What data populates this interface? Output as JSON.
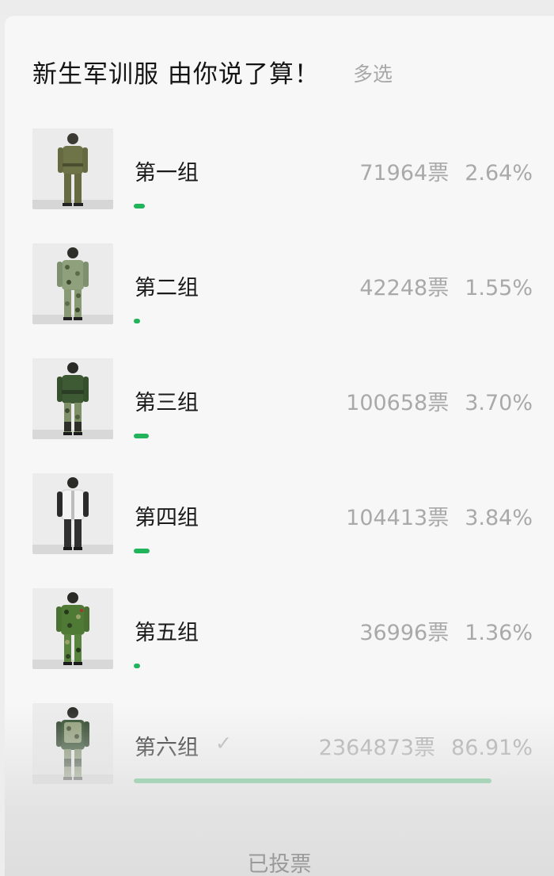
{
  "poll": {
    "title": "新生军训服 由你说了算！",
    "mode": "多选",
    "status": "已投票",
    "accent_color": "#22b45a",
    "options": [
      {
        "label": "第一组",
        "votes": "71964票",
        "percent": "2.64%",
        "share": 0.0264,
        "selected": false,
        "uniform": "olive"
      },
      {
        "label": "第二组",
        "votes": "42248票",
        "percent": "1.55%",
        "share": 0.0155,
        "selected": false,
        "uniform": "camo-light"
      },
      {
        "label": "第三组",
        "votes": "100658票",
        "percent": "3.70%",
        "share": 0.037,
        "selected": false,
        "uniform": "camo-dark-top"
      },
      {
        "label": "第四组",
        "votes": "104413票",
        "percent": "3.84%",
        "share": 0.0384,
        "selected": false,
        "uniform": "white-black-tracksuit"
      },
      {
        "label": "第五组",
        "votes": "36996票",
        "percent": "1.36%",
        "share": 0.0136,
        "selected": false,
        "uniform": "camo-green"
      },
      {
        "label": "第六组",
        "votes": "2364873票",
        "percent": "86.91%",
        "share": 0.8691,
        "selected": true,
        "check_icon": "checkmark-icon",
        "uniform": "camo-vest"
      }
    ]
  }
}
